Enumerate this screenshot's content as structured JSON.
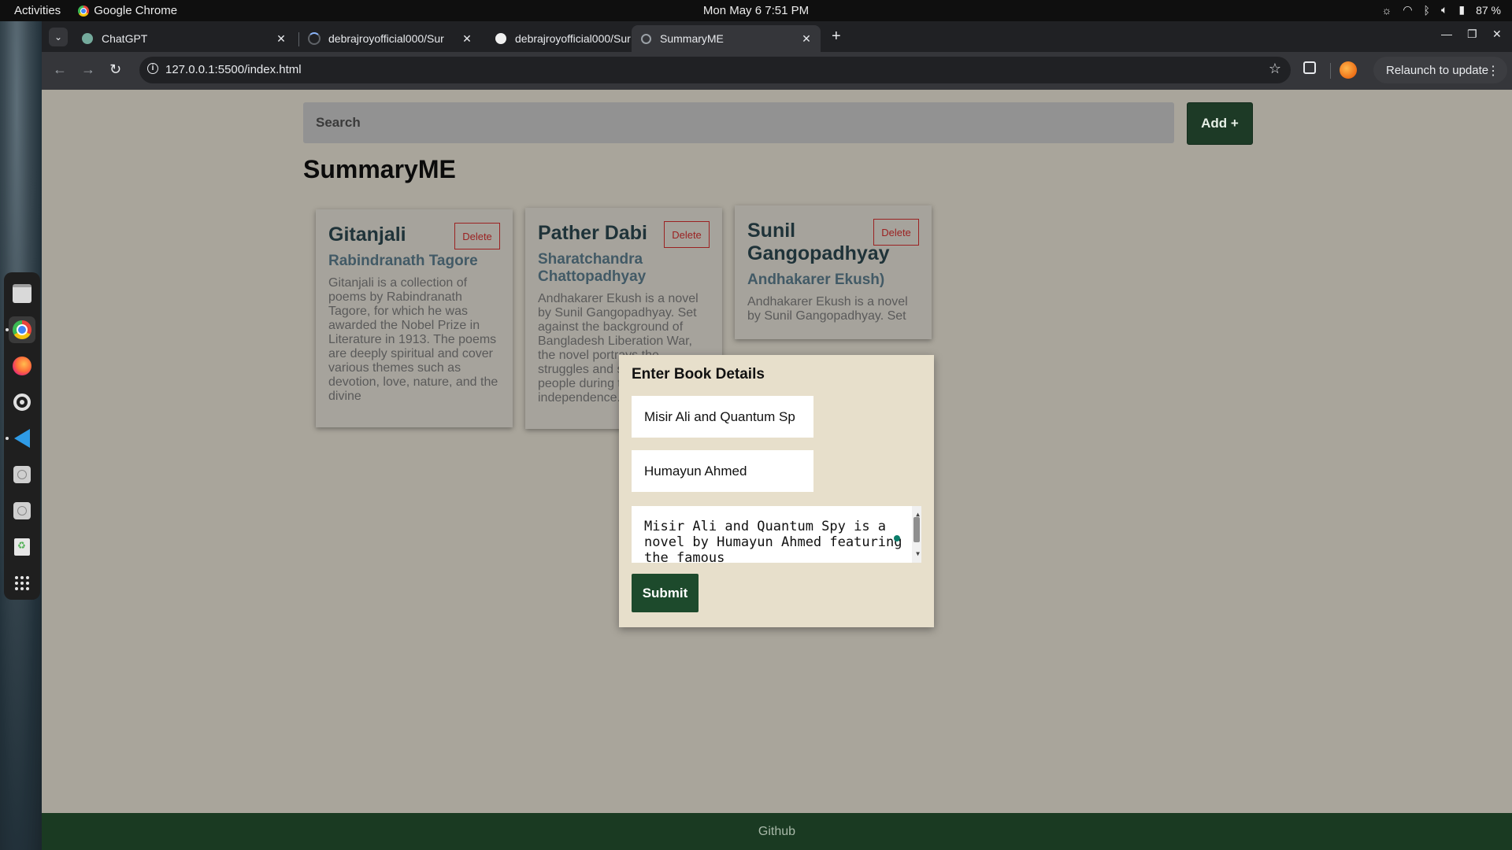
{
  "system_bar": {
    "activities": "Activities",
    "app_name": "Google Chrome",
    "clock": "Mon May 6   7:51 PM",
    "battery": "87 %"
  },
  "dock": {
    "items": [
      "files-icon",
      "chrome-icon",
      "firefox-icon",
      "settings-icon",
      "vscode-icon",
      "disk-icon",
      "disk-icon",
      "trash-icon",
      "app-grid-icon"
    ]
  },
  "browser": {
    "tabs": [
      {
        "label": "ChatGPT",
        "favicon": "chatgpt-icon"
      },
      {
        "label": "debrajroyofficial000/Sur",
        "favicon": "loading-icon"
      },
      {
        "label": "debrajroyofficial000/Sur",
        "favicon": "github-icon"
      },
      {
        "label": "SummaryME",
        "favicon": "globe-icon",
        "active": true
      }
    ],
    "new_tab": "+",
    "url": "127.0.0.1:5500/index.html",
    "relaunch_label": "Relaunch to update"
  },
  "page": {
    "search_placeholder": "Search",
    "add_button": "Add +",
    "site_title": "SummaryME",
    "delete_label": "Delete",
    "cards": [
      {
        "title": "Gitanjali",
        "author": "Rabindranath Tagore",
        "summary": "Gitanjali is a collection of poems by Rabindranath Tagore, for which he was awarded the Nobel Prize in Literature in 1913. The poems are deeply spiritual and cover various themes such as devotion, love, nature, and the divine"
      },
      {
        "title": "Pather Dabi",
        "author": "Sharatchandra Chattopadhyay",
        "summary": "Andhakarer Ekush is a novel by Sunil Gangopadhyay. Set against the background of Bangladesh Liberation War, the novel portrays the struggles and sacrifices of people during the fight for independence."
      },
      {
        "title": "Sunil Gangopadhyay",
        "author": "Andhakarer Ekush)",
        "summary": "Andhakarer Ekush is a novel by Sunil Gangopadhyay. Set"
      }
    ],
    "modal": {
      "title": "Enter Book Details",
      "book_name_value": "Misir Ali and Quantum Sp",
      "author_value": "Humayun Ahmed",
      "summary_value": "Misir Ali and Quantum Spy is a novel by Humayun Ahmed featuring the famous",
      "submit_label": "Submit"
    },
    "footer_link": "Github"
  },
  "colors": {
    "page_bg": "#a9a59b",
    "accent_green": "#1d3a26",
    "delete_red": "#9b2222",
    "modal_bg": "#e7dfcb"
  }
}
